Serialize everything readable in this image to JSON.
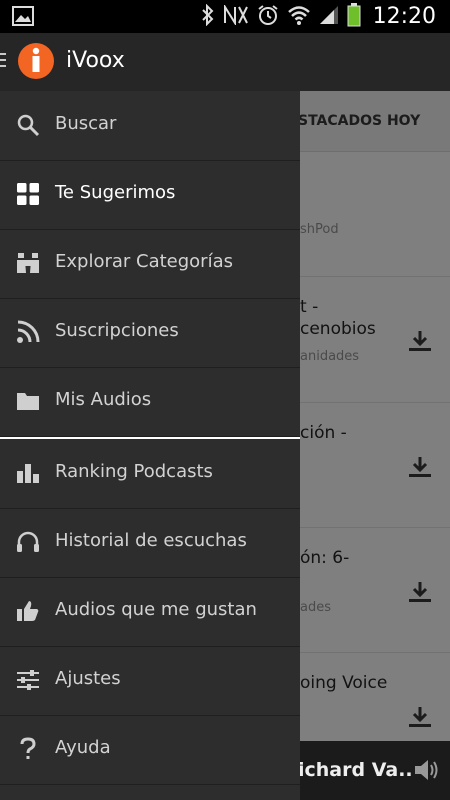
{
  "status_bar": {
    "time": "12:20"
  },
  "app": {
    "title": "iVoox"
  },
  "drawer": {
    "items": [
      {
        "label": "Buscar",
        "icon": "search-icon"
      },
      {
        "label": "Te Sugerimos",
        "icon": "grid-icon",
        "active": true
      },
      {
        "label": "Explorar Categorías",
        "icon": "binoculars-icon"
      },
      {
        "label": "Suscripciones",
        "icon": "rss-icon"
      },
      {
        "label": "Mis Audios",
        "icon": "folder-icon"
      },
      {
        "label": "Ranking Podcasts",
        "icon": "bar-chart-icon"
      },
      {
        "label": "Historial de escuchas",
        "icon": "headphones-icon"
      },
      {
        "label": "Audios que me gustan",
        "icon": "thumbs-up-icon"
      },
      {
        "label": "Ajustes",
        "icon": "sliders-icon"
      },
      {
        "label": "Ayuda",
        "icon": "question-icon"
      }
    ]
  },
  "background": {
    "tab_label": "STACADOS HOY",
    "rows": [
      {
        "title": "",
        "subtitle": "shPod"
      },
      {
        "title": "t -",
        "title2": "cenobios",
        "subtitle": "anidades"
      },
      {
        "title": "ción -",
        "title2": "",
        "subtitle": ""
      },
      {
        "title": "ón: 6-",
        "title2": "",
        "subtitle": "ades"
      },
      {
        "title": "oing Voice",
        "title2": "",
        "subtitle": ""
      }
    ],
    "player_title": "ichard Va.."
  },
  "colors": {
    "brand": "#f26522",
    "drawer_bg": "#2d2d2d",
    "appbar_bg": "#262626"
  }
}
